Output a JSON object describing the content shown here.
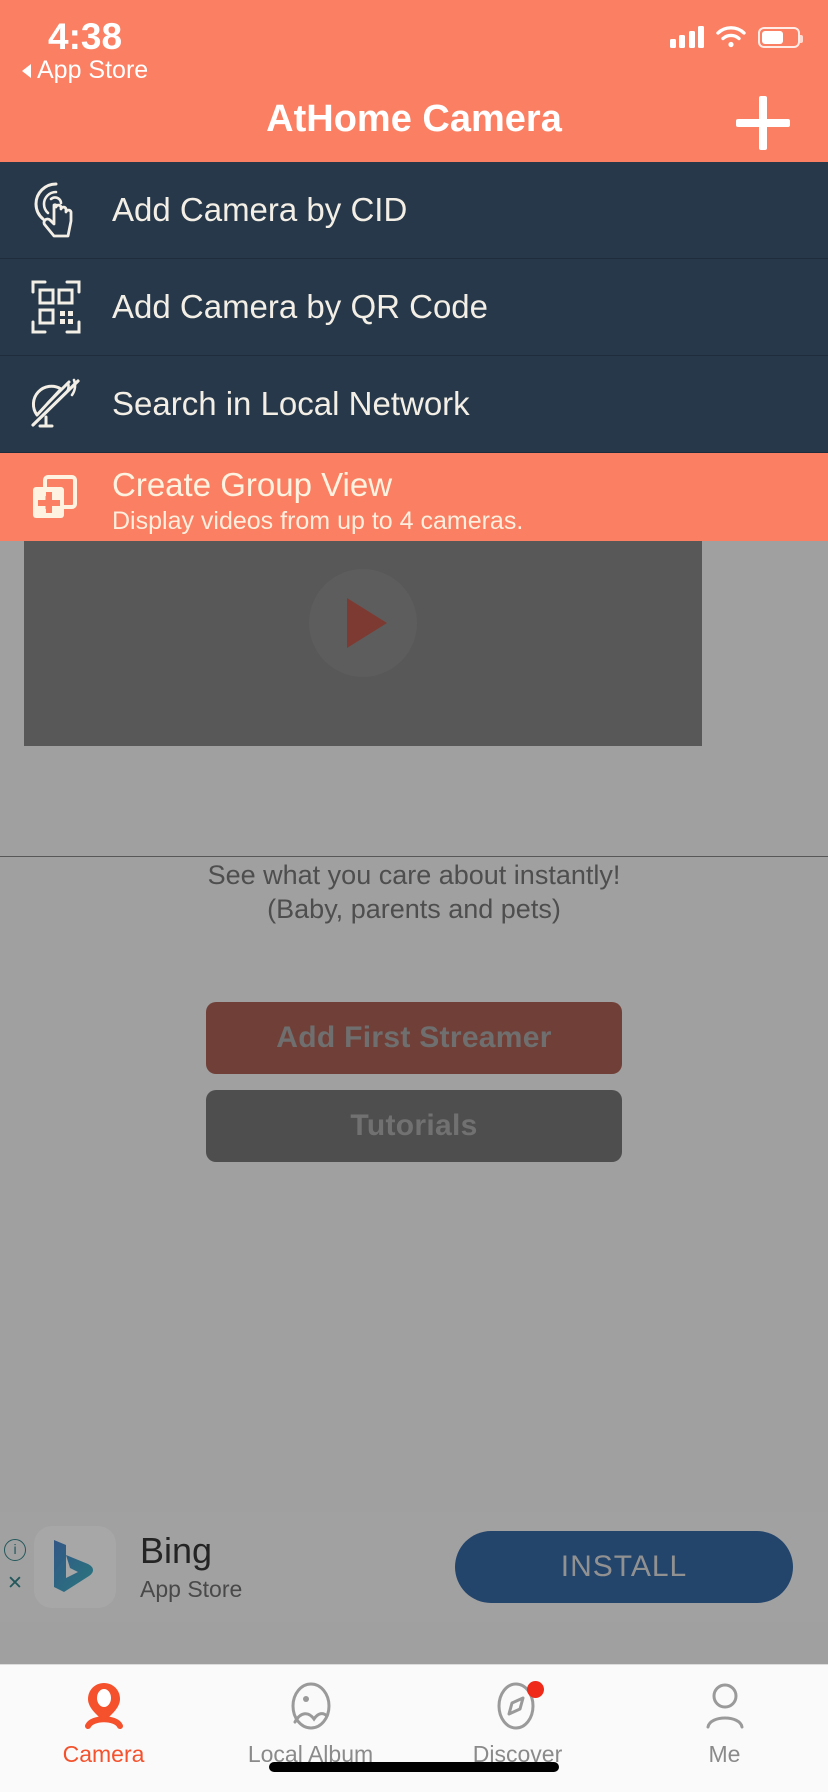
{
  "status_bar": {
    "time": "4:38",
    "back_label": "App Store",
    "back_icon": "triangle-left-icon",
    "signal_icon": "cellular-signal-icon",
    "wifi_icon": "wifi-icon",
    "battery_icon": "battery-icon",
    "battery_level": "62%"
  },
  "header": {
    "title": "AtHome Camera",
    "add_icon": "plus-icon",
    "background_color": "#fb7f62"
  },
  "menu": {
    "items": [
      {
        "label": "Add Camera by CID",
        "icon": "touch-hand-icon",
        "highlighted": false
      },
      {
        "label": "Add Camera by QR Code",
        "icon": "qr-code-icon",
        "highlighted": false
      },
      {
        "label": "Search in Local Network",
        "icon": "satellite-dish-icon",
        "highlighted": false
      },
      {
        "label": "Create Group View",
        "subtitle": "Display videos from up to 4 cameras.",
        "icon": "group-view-add-icon",
        "highlighted": true
      }
    ]
  },
  "content": {
    "video_play_icon": "play-icon",
    "promo_line1": "See what you care about instantly!",
    "promo_line2": "(Baby, parents and pets)",
    "primary_button": "Add First Streamer",
    "secondary_button": "Tutorials"
  },
  "ad": {
    "info_icon": "info-icon",
    "close_icon": "close-icon",
    "app_icon": "bing-logo-icon",
    "title": "Bing",
    "subtitle": "App Store",
    "install_label": "INSTALL",
    "install_color": "#0f4c92"
  },
  "tabbar": {
    "items": [
      {
        "label": "Camera",
        "icon": "camera-pin-icon",
        "active": true,
        "badge": false
      },
      {
        "label": "Local Album",
        "icon": "photo-album-icon",
        "active": false,
        "badge": false
      },
      {
        "label": "Discover",
        "icon": "compass-icon",
        "active": false,
        "badge": true
      },
      {
        "label": "Me",
        "icon": "person-icon",
        "active": false,
        "badge": false
      }
    ],
    "active_color": "#f4512c"
  }
}
